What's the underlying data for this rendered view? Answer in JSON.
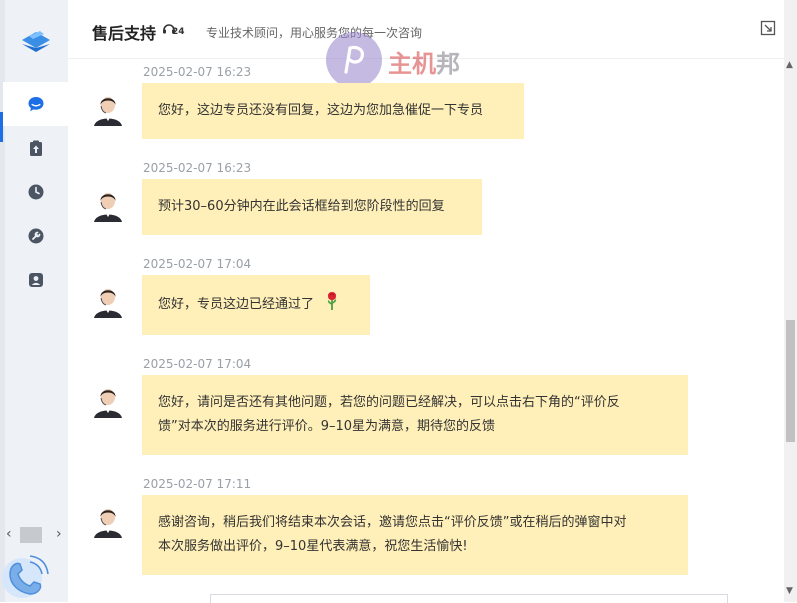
{
  "header": {
    "title": "售后支持",
    "badge": "24",
    "subtitle": "专业技术顾问，用心服务您的每一次咨询"
  },
  "watermark": {
    "text_a": "主机",
    "text_b": "邦"
  },
  "nav": [
    {
      "icon": "chat-bubble-icon",
      "active": true
    },
    {
      "icon": "clipboard-upload-icon",
      "active": false
    },
    {
      "icon": "clock-icon",
      "active": false
    },
    {
      "icon": "wrench-icon",
      "active": false
    },
    {
      "icon": "user-badge-icon",
      "active": false
    }
  ],
  "messages": [
    {
      "time": "2025-02-07 16:23",
      "text": "您好，这边专员还没有回复，这边为您加急催促一下专员"
    },
    {
      "time": "2025-02-07 16:23",
      "text": "预计30–60分钟内在此会话框给到您阶段性的回复"
    },
    {
      "time": "2025-02-07 17:04",
      "text": "您好，专员这边已经通过了",
      "emoji": "rose-emoji-icon"
    },
    {
      "time": "2025-02-07 17:04",
      "line1": "您好，请问是否还有其他问题，若您的问题已经解决，可以点击右下角的“评价反",
      "line2": "馈”对本次的服务进行评价。9–10星为满意，期待您的反馈"
    },
    {
      "time": "2025-02-07 17:11",
      "line1": "感谢咨询，稍后我们将结束本次会话，邀请您点击“评价反馈”或在稍后的弹窗中对",
      "line2": "本次服务做出评价，9–10星代表满意，祝您生活愉快!"
    }
  ],
  "colors": {
    "bubble": "#ffefb8",
    "rail": "#eef2f7",
    "accent": "#1e6fe6",
    "timestamp": "#9aa0a6"
  }
}
